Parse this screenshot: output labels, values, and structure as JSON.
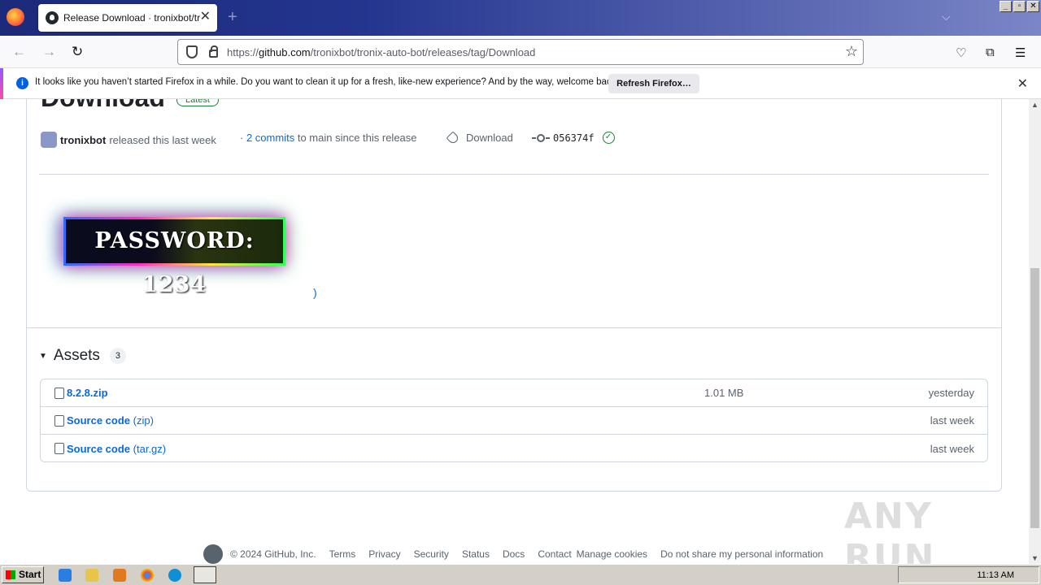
{
  "browser": {
    "tab_title": "Release Download · tronixbot/tronix-auto-bot",
    "url_prefix": "https://",
    "url_domain": "github.com",
    "url_path": "/tronixbot/tronix-auto-bot/releases/tag/Download"
  },
  "notification": {
    "message": "It looks like you haven’t started Firefox in a while. Do you want to clean it up for a fresh, like-new experience? And by the way, welcome back!",
    "button": "Refresh Firefox…"
  },
  "release": {
    "title": "Download",
    "badge": "Latest",
    "author": "tronixbot",
    "released": "released this last week",
    "commits_link": "2 commits",
    "commits_text": "to main since this release",
    "commits_prefix": "·",
    "tag": "Download",
    "sha": "056374f",
    "password_banner": "PASSWORD: 1234",
    "caret": ")"
  },
  "assets": {
    "label": "Assets",
    "count": "3",
    "items": [
      {
        "name": "8.2.8.zip",
        "ext": "",
        "size": "1.01 MB",
        "date": "yesterday"
      },
      {
        "name": "Source code",
        "ext": "(zip)",
        "size": "",
        "date": "last week"
      },
      {
        "name": "Source code",
        "ext": "(tar.gz)",
        "size": "",
        "date": "last week"
      }
    ]
  },
  "footer": {
    "copyright": "© 2024 GitHub, Inc.",
    "links": [
      "Terms",
      "Privacy",
      "Security",
      "Status",
      "Docs",
      "Contact",
      "Manage cookies",
      "Do not share my personal information"
    ]
  },
  "taskbar": {
    "start": "Start",
    "clock": "11:13 AM"
  },
  "watermark": "ANY RUN"
}
